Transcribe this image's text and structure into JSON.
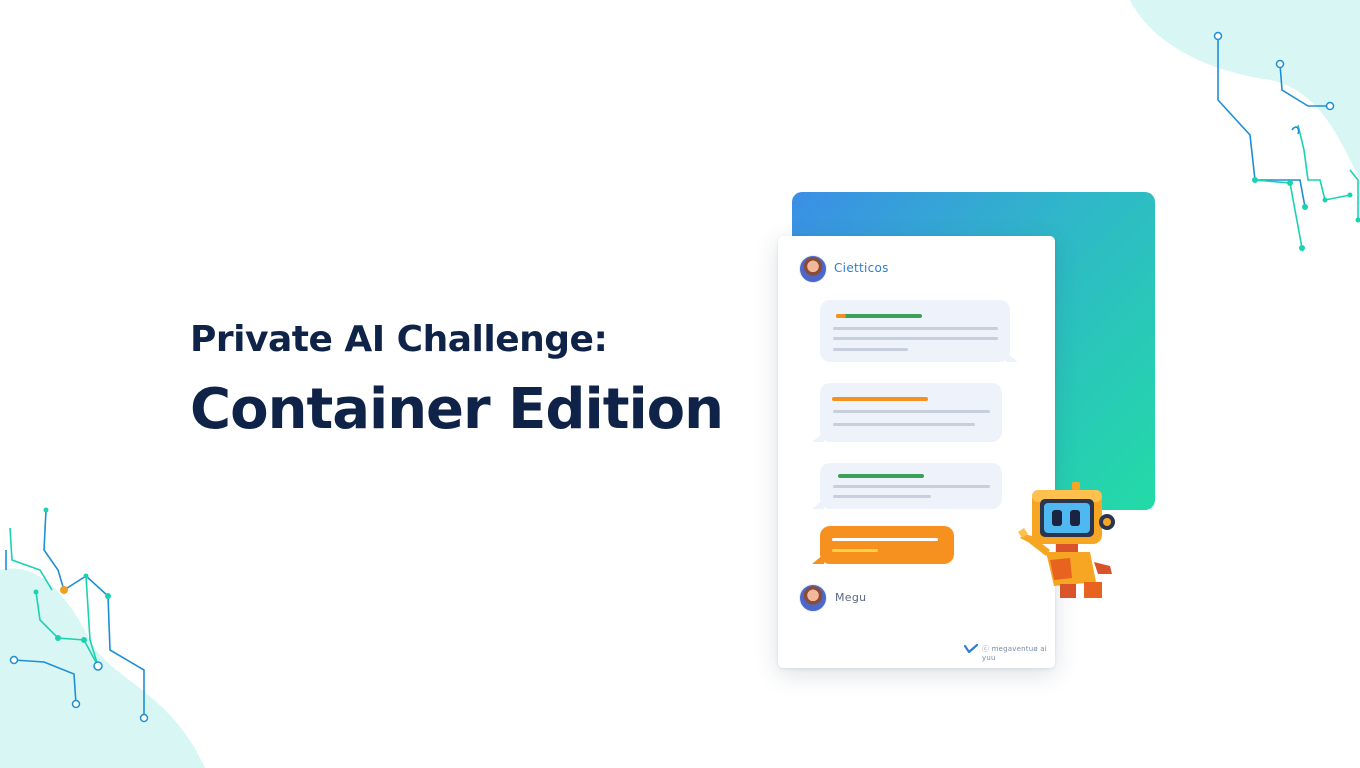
{
  "headline": {
    "line1": "Private AI Challenge:",
    "line2": "Container Edition"
  },
  "chat": {
    "header_name": "Cietticos",
    "footer_name": "Megu",
    "footer_brand": "ⓒ megaventuø ai yuu"
  },
  "colors": {
    "title": "#0f2348",
    "accent_orange": "#f6901e",
    "accent_green": "#3aa05a",
    "gradient_start": "#3b8ee6",
    "gradient_end": "#22dba6",
    "circuit_blue": "#1e8fd6",
    "circuit_teal": "#19d3b0",
    "blob": "#d8f6f4"
  },
  "icons": {
    "avatar": "user-avatar-icon",
    "robot": "robot-mascot-icon",
    "brand": "checkmark-logo-icon"
  }
}
